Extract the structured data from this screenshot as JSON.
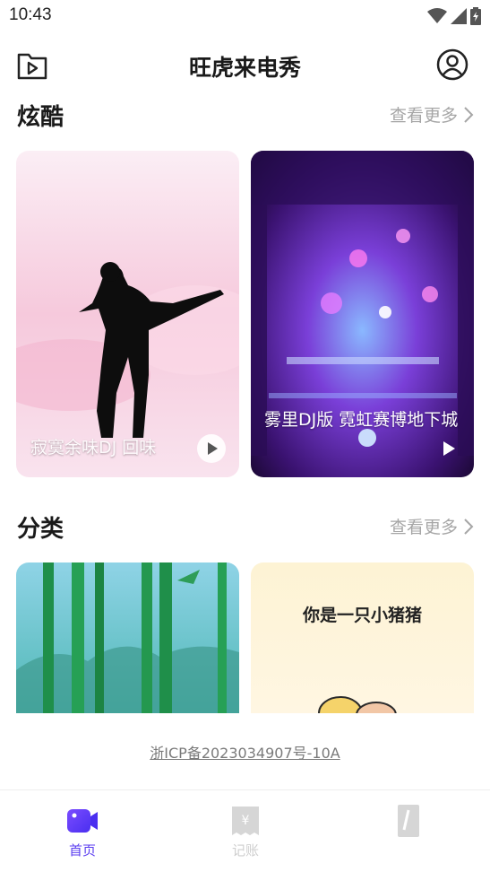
{
  "status_bar": {
    "time": "10:43"
  },
  "header": {
    "title": "旺虎来电秀"
  },
  "sections": {
    "cool": {
      "title": "炫酷",
      "see_more": "查看更多"
    },
    "category": {
      "title": "分类",
      "see_more": "查看更多"
    }
  },
  "cool_cards": [
    {
      "caption": "寂寞余味DJ 回味",
      "theme": "pink-silhouette"
    },
    {
      "caption": "雾里DJ版 霓虹赛博地下城",
      "theme": "neon-cyber"
    }
  ],
  "category_cards": [
    {
      "caption": "",
      "theme": "bamboo"
    },
    {
      "caption": "你是一只小猪猪",
      "theme": "cartoon-yellow"
    }
  ],
  "footer": {
    "icp": "浙ICP备2023034907号-10A"
  },
  "bottom_nav": [
    {
      "label": "首页",
      "icon": "video-camera-icon",
      "active": true
    },
    {
      "label": "记账",
      "icon": "receipt-icon",
      "active": false
    },
    {
      "label": "",
      "icon": "ruler-icon",
      "active": false
    }
  ],
  "colors": {
    "accent": "#5b3ef0",
    "muted": "#a6a6a6"
  }
}
